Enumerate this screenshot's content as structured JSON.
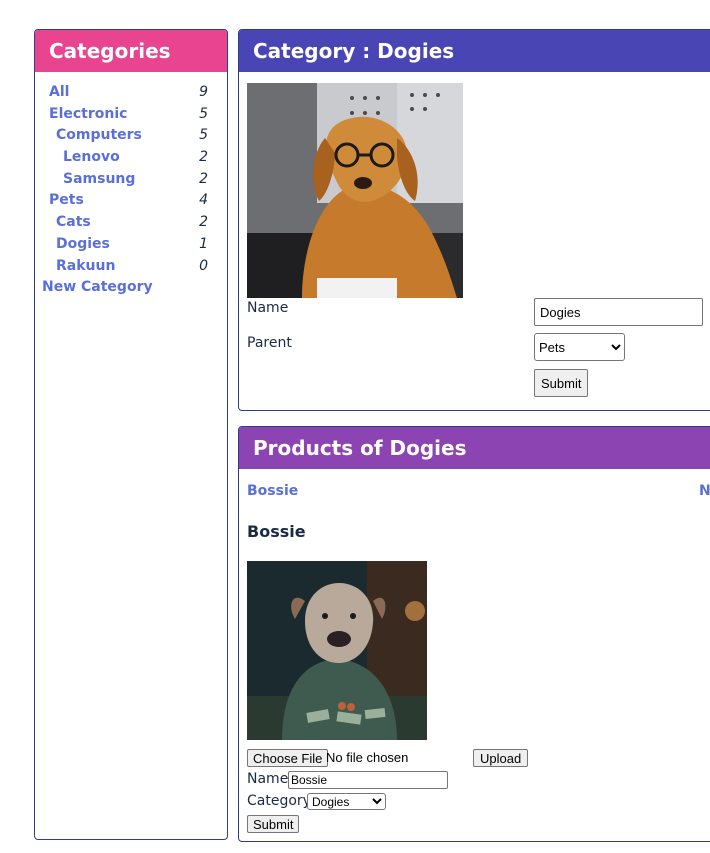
{
  "sidebar": {
    "title": "Categories",
    "items": [
      {
        "label": "All",
        "count": "9"
      },
      {
        "label": "Electronic",
        "count": "5"
      },
      {
        "label": "Computers",
        "count": "5"
      },
      {
        "label": "Lenovo",
        "count": "2"
      },
      {
        "label": "Samsung",
        "count": "2"
      },
      {
        "label": "Pets",
        "count": "4"
      },
      {
        "label": "Cats",
        "count": "2"
      },
      {
        "label": "Dogies",
        "count": "1"
      },
      {
        "label": "Rakuun",
        "count": "0"
      }
    ],
    "new_category": "New Category"
  },
  "category_panel": {
    "title": "Category : Dogies",
    "name_label": "Name",
    "name_value": "Dogies",
    "parent_label": "Parent",
    "parent_value": "Pets",
    "submit": "Submit"
  },
  "products_panel": {
    "title": "Products of Dogies",
    "product_link": "Bossie",
    "right_link": "N",
    "product_heading": "Bossie",
    "choose_file": "Choose File",
    "no_file": "No file chosen",
    "upload": "Upload",
    "name_label": "Name",
    "name_value": "Bossie",
    "category_label": "Category",
    "category_value": "Dogies",
    "submit": "Submit"
  },
  "colors": {
    "sidebar_header": "#e8448f",
    "category_header": "#4a45b5",
    "products_header": "#8c44b2",
    "link": "#5a6fd8",
    "border": "#2e3e8a"
  }
}
